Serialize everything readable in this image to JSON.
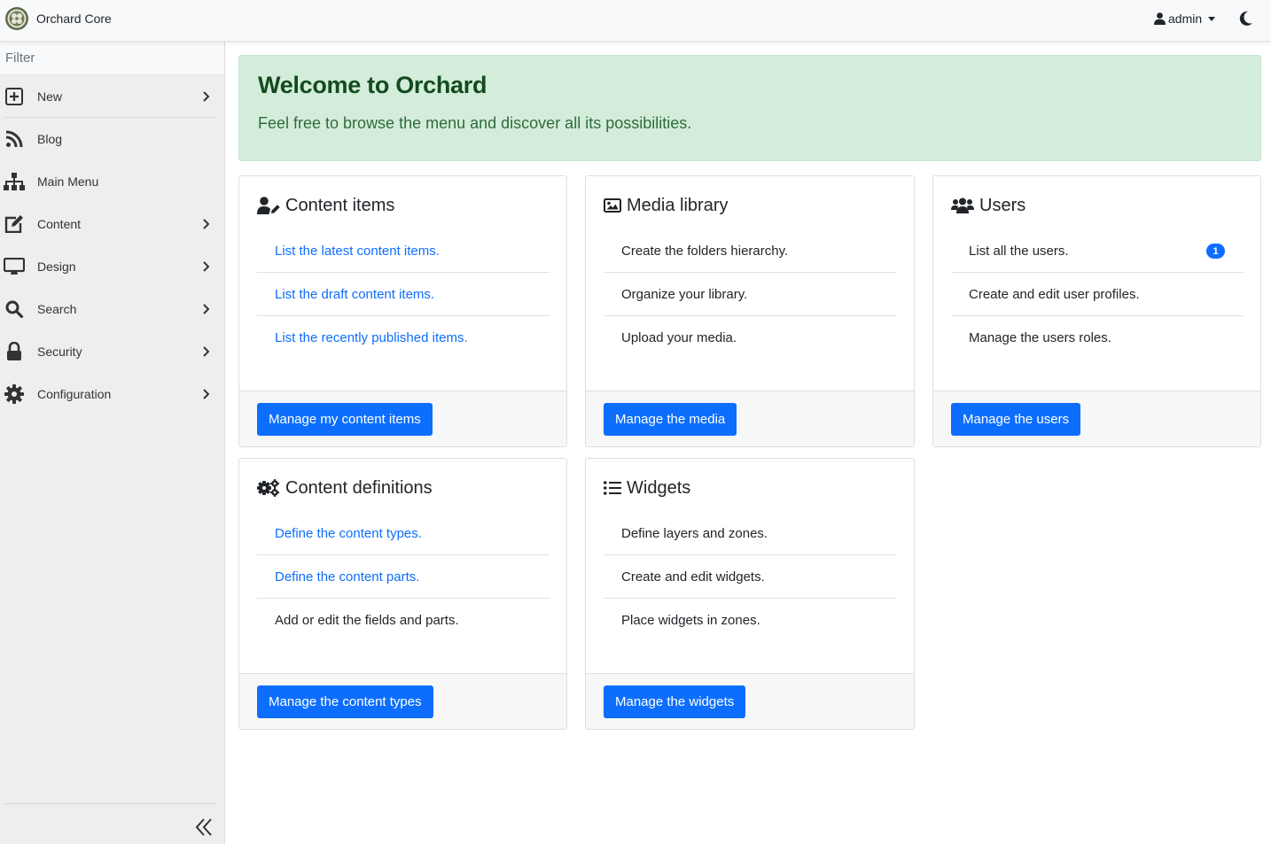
{
  "header": {
    "brand": "Orchard Core",
    "user": "admin"
  },
  "sidebar": {
    "filter_placeholder": "Filter",
    "items": [
      {
        "label": "New",
        "icon": "plus-square-icon",
        "has_children": true
      },
      {
        "label": "Blog",
        "icon": "rss-icon",
        "has_children": false
      },
      {
        "label": "Main Menu",
        "icon": "sitemap-icon",
        "has_children": false
      },
      {
        "label": "Content",
        "icon": "edit-icon",
        "has_children": true
      },
      {
        "label": "Design",
        "icon": "desktop-icon",
        "has_children": true
      },
      {
        "label": "Search",
        "icon": "search-icon",
        "has_children": true
      },
      {
        "label": "Security",
        "icon": "lock-icon",
        "has_children": true
      },
      {
        "label": "Configuration",
        "icon": "cog-icon",
        "has_children": true
      }
    ]
  },
  "welcome": {
    "title": "Welcome to Orchard",
    "subtitle": "Feel free to browse the menu and discover all its possibilities."
  },
  "cards": {
    "content_items": {
      "title": "Content items",
      "items": [
        "List the latest content items.",
        "List the draft content items.",
        "List the recently published items."
      ],
      "button": "Manage my content items"
    },
    "media": {
      "title": "Media library",
      "items": [
        "Create the folders hierarchy.",
        "Organize your library.",
        "Upload your media."
      ],
      "button": "Manage the media"
    },
    "users": {
      "title": "Users",
      "items": [
        "List all the users.",
        "Create and edit user profiles.",
        "Manage the users roles."
      ],
      "badge": "1",
      "button": "Manage the users"
    },
    "content_definitions": {
      "title": "Content definitions",
      "items": [
        "Define the content types.",
        "Define the content parts.",
        "Add or edit the fields and parts."
      ],
      "button": "Manage the content types"
    },
    "widgets": {
      "title": "Widgets",
      "items": [
        "Define layers and zones.",
        "Create and edit widgets.",
        "Place widgets in zones."
      ],
      "button": "Manage the widgets"
    }
  },
  "colors": {
    "primary": "#0d6efd",
    "welcome_bg": "#d4eddb",
    "welcome_title": "#144b1e",
    "sidebar_bg": "#eeeeee"
  }
}
